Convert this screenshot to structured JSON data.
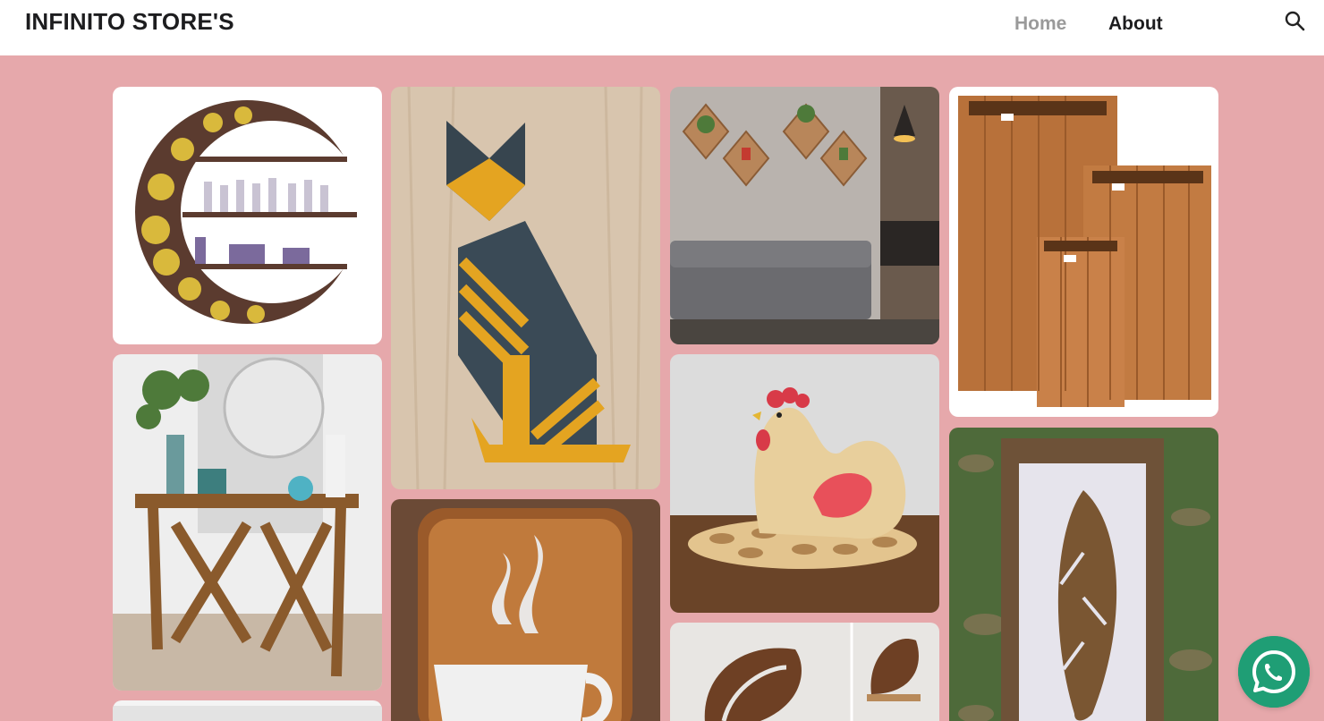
{
  "header": {
    "brand": "INFINITO STORE'S",
    "nav": {
      "home": "Home",
      "about": "About"
    },
    "search_icon": "search-icon"
  },
  "gallery": {
    "items": [
      {
        "name": "moon-phase-crystal-shelf"
      },
      {
        "name": "geometric-wooden-cat"
      },
      {
        "name": "diamond-wall-planters"
      },
      {
        "name": "wooden-planter-boxes"
      },
      {
        "name": "wooden-console-table"
      },
      {
        "name": "wooden-hen-egg-holder"
      },
      {
        "name": "wooden-coffee-cup-sign"
      },
      {
        "name": "wooden-feather-frame"
      },
      {
        "name": "monstera-leaf-wall-art"
      },
      {
        "name": "partial-item"
      }
    ]
  },
  "floating": {
    "icon": "whatsapp-icon"
  },
  "colors": {
    "background": "#e6a8ab",
    "header": "#ffffff",
    "whatsapp": "#1f9e75"
  }
}
